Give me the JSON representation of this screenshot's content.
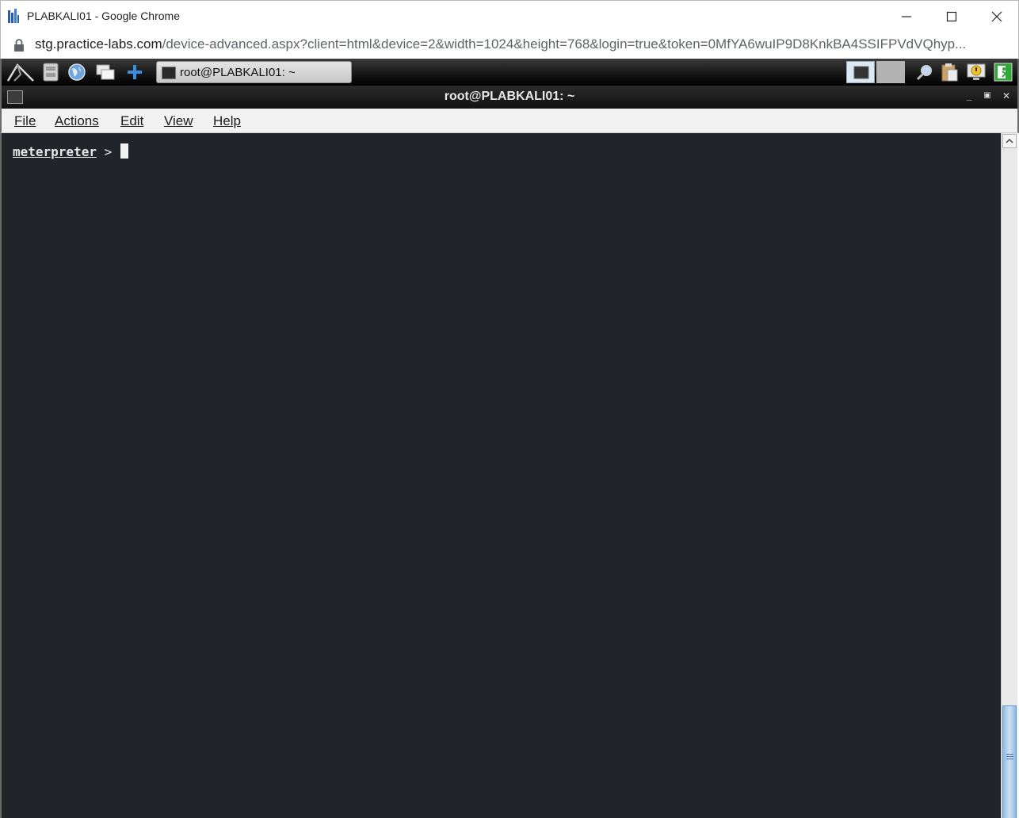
{
  "browser": {
    "title": "PLABKALI01 - Google Chrome",
    "url_host": "stg.practice-labs.com",
    "url_path": "/device-advanced.aspx?client=html&device=2&width=1024&height=768&login=true&token=0MfYA6wuIP9D8KnkBA4SSIFPVdVQhyp..."
  },
  "panel": {
    "task_label": "root@PLABKALI01: ~"
  },
  "terminal_window": {
    "title": "root@PLABKALI01: ~",
    "menu": [
      "File",
      "Actions",
      "Edit",
      "View",
      "Help"
    ]
  },
  "terminal": {
    "prompt_name": "meterpreter",
    "prompt_symbol": " > "
  },
  "colors": {
    "terminal_bg": "#212529",
    "scroll_thumb": "#8fb9e4"
  }
}
